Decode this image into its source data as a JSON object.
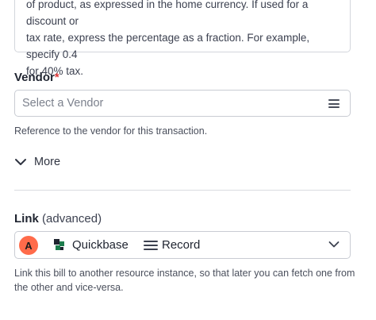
{
  "description_box": {
    "line1": "of product, as expressed in the home currency. If used for a discount or",
    "line2": "tax rate, express the percentage as a fraction. For example, specify 0.4",
    "line3": "for 40% tax."
  },
  "vendor": {
    "label": "Vendor",
    "required_mark": "*",
    "placeholder": "Select a Vendor",
    "help": "Reference to the vendor for this transaction."
  },
  "more": {
    "label": "More"
  },
  "link": {
    "label": "Link",
    "label_suffix": "(advanced)",
    "avatar_letter": "A",
    "app_name": "Quickbase",
    "resource": "Record",
    "help_line1": "Link this bill to another resource instance, so that later you can fetch one from",
    "help_line2": "the other and vice-versa."
  },
  "colors": {
    "required": "#e03a3a",
    "avatar": "#ff6b4a",
    "logo_green": "#1c7c4d",
    "logo_dark": "#1f2430"
  },
  "icons": {
    "vendor_menu": "menu-icon",
    "more_toggle": "chevron-down-icon",
    "app_logo": "quickbase-logo-icon",
    "resource_separator": "menu-icon",
    "link_dropdown": "chevron-down-icon"
  }
}
